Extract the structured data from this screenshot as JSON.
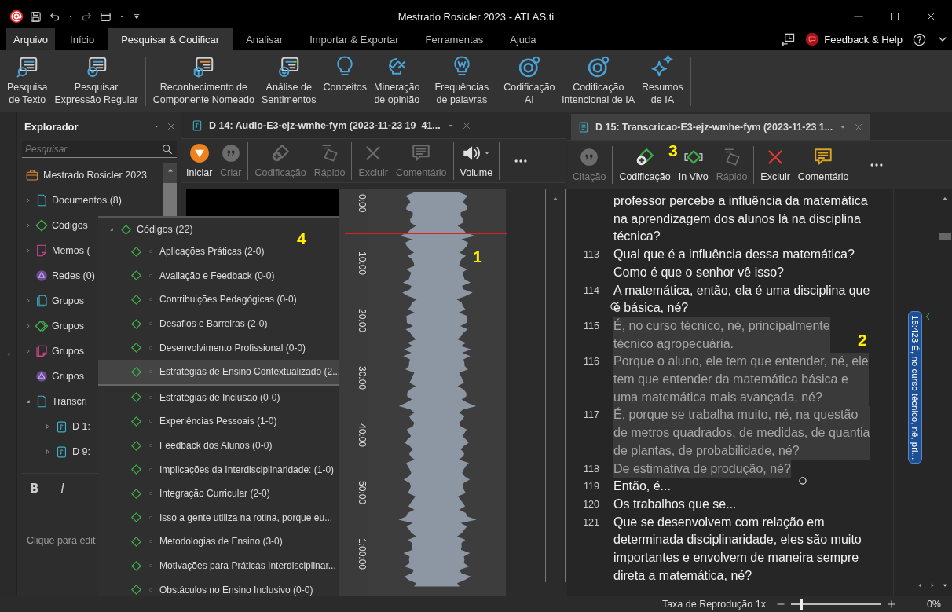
{
  "window": {
    "title": "Mestrado Rosicler 2023 - ATLAS.ti"
  },
  "menu_tabs": [
    {
      "label": "Arquivo",
      "kind": "file",
      "selected": false
    },
    {
      "label": "Início",
      "kind": "tab",
      "selected": false
    },
    {
      "label": "Pesquisar & Codificar",
      "kind": "tab",
      "selected": true
    },
    {
      "label": "Analisar",
      "kind": "tab",
      "selected": false
    },
    {
      "label": "Importar & Exportar",
      "kind": "tab",
      "selected": false
    },
    {
      "label": "Ferramentas",
      "kind": "tab",
      "selected": false
    },
    {
      "label": "Ajuda",
      "kind": "tab",
      "selected": false
    }
  ],
  "help": {
    "label": "Feedback & Help"
  },
  "ribbon": [
    [
      {
        "lines": [
          "Pesquisa",
          "de Texto"
        ]
      },
      {
        "lines": [
          "Pesquisar",
          "Expressão Regular"
        ]
      }
    ],
    [
      {
        "lines": [
          "Reconhecimento de",
          "Componente Nomeado"
        ]
      },
      {
        "lines": [
          "Análise de",
          "Sentimentos"
        ]
      },
      {
        "lines": [
          "Conceitos"
        ]
      },
      {
        "lines": [
          "Mineração",
          "de opinião"
        ]
      }
    ],
    [
      {
        "lines": [
          "Frequências",
          "de palavras"
        ]
      }
    ],
    [
      {
        "lines": [
          "Codificação",
          "AI"
        ]
      },
      {
        "lines": [
          "Codificação",
          "intencional de IA"
        ]
      },
      {
        "lines": [
          "Resumos",
          "de IA"
        ]
      }
    ]
  ],
  "explorer": {
    "title": "Explorador",
    "search": {
      "placeholder": "Pesquisar"
    },
    "tree": [
      {
        "label": "Mestrado Rosicler 2023",
        "children": [
          {
            "label": "Documentos (8)",
            "expanded": false
          },
          {
            "label": "Códigos",
            "expanded": false
          },
          {
            "label": "Memos (",
            "expanded": false
          },
          {
            "label": "Redes (0)"
          },
          {
            "label": "Grupos",
            "expanded": false
          },
          {
            "label": "Grupos",
            "expanded": false
          },
          {
            "label": "Grupos",
            "expanded": false
          },
          {
            "label": "Grupos"
          },
          {
            "label": "Transcri",
            "expanded": true,
            "children": [
              {
                "label": "D 1:",
                "expanded": false
              },
              {
                "label": "D 9:",
                "expanded": false
              }
            ]
          }
        ]
      }
    ],
    "format_buttons": [
      {
        "label": "B",
        "kind": "bold"
      },
      {
        "label": "I",
        "kind": "italic"
      }
    ],
    "note_placeholder": "Clique para edit"
  },
  "codes_popup": {
    "title": "Códigos (22)",
    "expanded": true,
    "items": [
      {
        "label": "Aplicações Práticas (2-0)",
        "selected": false
      },
      {
        "label": "Avaliação e Feedback (0-0)",
        "selected": false
      },
      {
        "label": "Contribuições Pedagógicas (0-0)",
        "selected": false
      },
      {
        "label": "Desafios e Barreiras (2-0)",
        "selected": false
      },
      {
        "label": "Desenvolvimento Profissional (0-0)",
        "selected": false
      },
      {
        "label": "Estratégias de Ensino Contextualizado (2...",
        "selected": true
      },
      {
        "label": "Estratégias de Inclusão (0-0)",
        "selected": false
      },
      {
        "label": "Experiências Pessoais (1-0)",
        "selected": false
      },
      {
        "label": "Feedback dos Alunos (0-0)",
        "selected": false
      },
      {
        "label": "Implicações da Interdisciplinaridade: (1-0)",
        "selected": false
      },
      {
        "label": "Integração Curricular (2-0)",
        "selected": false
      },
      {
        "label": "Isso a gente utiliza na rotina, porque eu...",
        "selected": false
      },
      {
        "label": "Metodologias de Ensino (3-0)",
        "selected": false
      },
      {
        "label": "Motivações para Práticas Interdisciplinar...",
        "selected": false
      },
      {
        "label": "Obstáculos no Ensino Inclusivo (0-0)",
        "selected": false
      }
    ]
  },
  "audio_doc": {
    "tab": {
      "title": "D 14: Audio-E3-ejz-wmhe-fym (2023-11-23 19_41...",
      "selected": false
    },
    "toolbar": [
      [
        {
          "label": "Iniciar",
          "disabled": false
        },
        {
          "label": "Criar",
          "disabled": true
        }
      ],
      [
        {
          "label": "Codificação",
          "disabled": true
        },
        {
          "label": "Rápido",
          "disabled": true
        }
      ],
      [
        {
          "label": "Excluir",
          "disabled": true
        },
        {
          "label": "Comentário",
          "disabled": true
        }
      ],
      [
        {
          "label": "Volume",
          "disabled": false
        }
      ]
    ],
    "ruler_labels": [
      "0:00",
      "10:00",
      "20:00",
      "30:00",
      "40:00",
      "50:00",
      "1:00:00"
    ]
  },
  "transcript_doc": {
    "tab": {
      "title": "D 15: Transcricao-E3-ejz-wmhe-fym (2023-11-23 1...",
      "selected": true
    },
    "toolbar": [
      [
        {
          "label": "Citação",
          "disabled": true
        }
      ],
      [
        {
          "label": "Codificação",
          "disabled": false
        },
        {
          "label": "In Vivo",
          "disabled": false
        },
        {
          "label": "Rápido",
          "disabled": true
        }
      ],
      [
        {
          "label": "Excluir",
          "disabled": false
        },
        {
          "label": "Comentário",
          "disabled": false
        }
      ]
    ],
    "paragraphs": [
      {
        "lines": [
          "professor percebe a influência da matemática",
          "na aprendizagem dos alunos lá na disciplina",
          "técnica?"
        ],
        "selected": false
      },
      {
        "number": "113",
        "lines": [
          "Qual que é a influência dessa matemática?",
          "Como é que o senhor vê isso?"
        ],
        "selected": false
      },
      {
        "number": "114",
        "lines": [
          "A matemática, então, ela é uma disciplina que",
          "é básica, né?"
        ],
        "selected": false
      },
      {
        "number": "115",
        "lines": [
          "É, no curso técnico, né, principalmente",
          "técnico agropecuária."
        ],
        "selected": true
      },
      {
        "number": "116",
        "lines": [
          "Porque o aluno, ele tem que entender, né, ele",
          "tem que entender da matemática básica e",
          "uma matemática mais avançada, né?"
        ],
        "selected": true
      },
      {
        "number": "117",
        "lines": [
          "É, porque se trabalha muito, né, na questão",
          "de metros quadrados, de medidas, de quantia",
          "de plantas, de probabilidade, né?"
        ],
        "selected": true
      },
      {
        "number": "118",
        "lines": [
          "De estimativa de produção, né?"
        ],
        "selected": true
      },
      {
        "number": "119",
        "lines": [
          "Então, é..."
        ],
        "selected": false
      },
      {
        "number": "120",
        "lines": [
          "Os trabalhos que se..."
        ],
        "selected": false
      },
      {
        "number": "121",
        "lines": [
          "Que se desenvolvem com relação em",
          "determinada disciplinaridade, eles são muito",
          "importantes e envolvem de maneira sempre",
          "direta a matemática, né?"
        ],
        "selected": false
      }
    ],
    "quotation": {
      "label": "15:423 É, no curso técnico, né, pri..."
    }
  },
  "status_bar": {
    "rate_label": "Taxa de Reprodução 1x",
    "rate": {
      "level": 0.1
    },
    "percent": "0%"
  },
  "annotations": [
    "1",
    "2",
    "3",
    "4"
  ]
}
